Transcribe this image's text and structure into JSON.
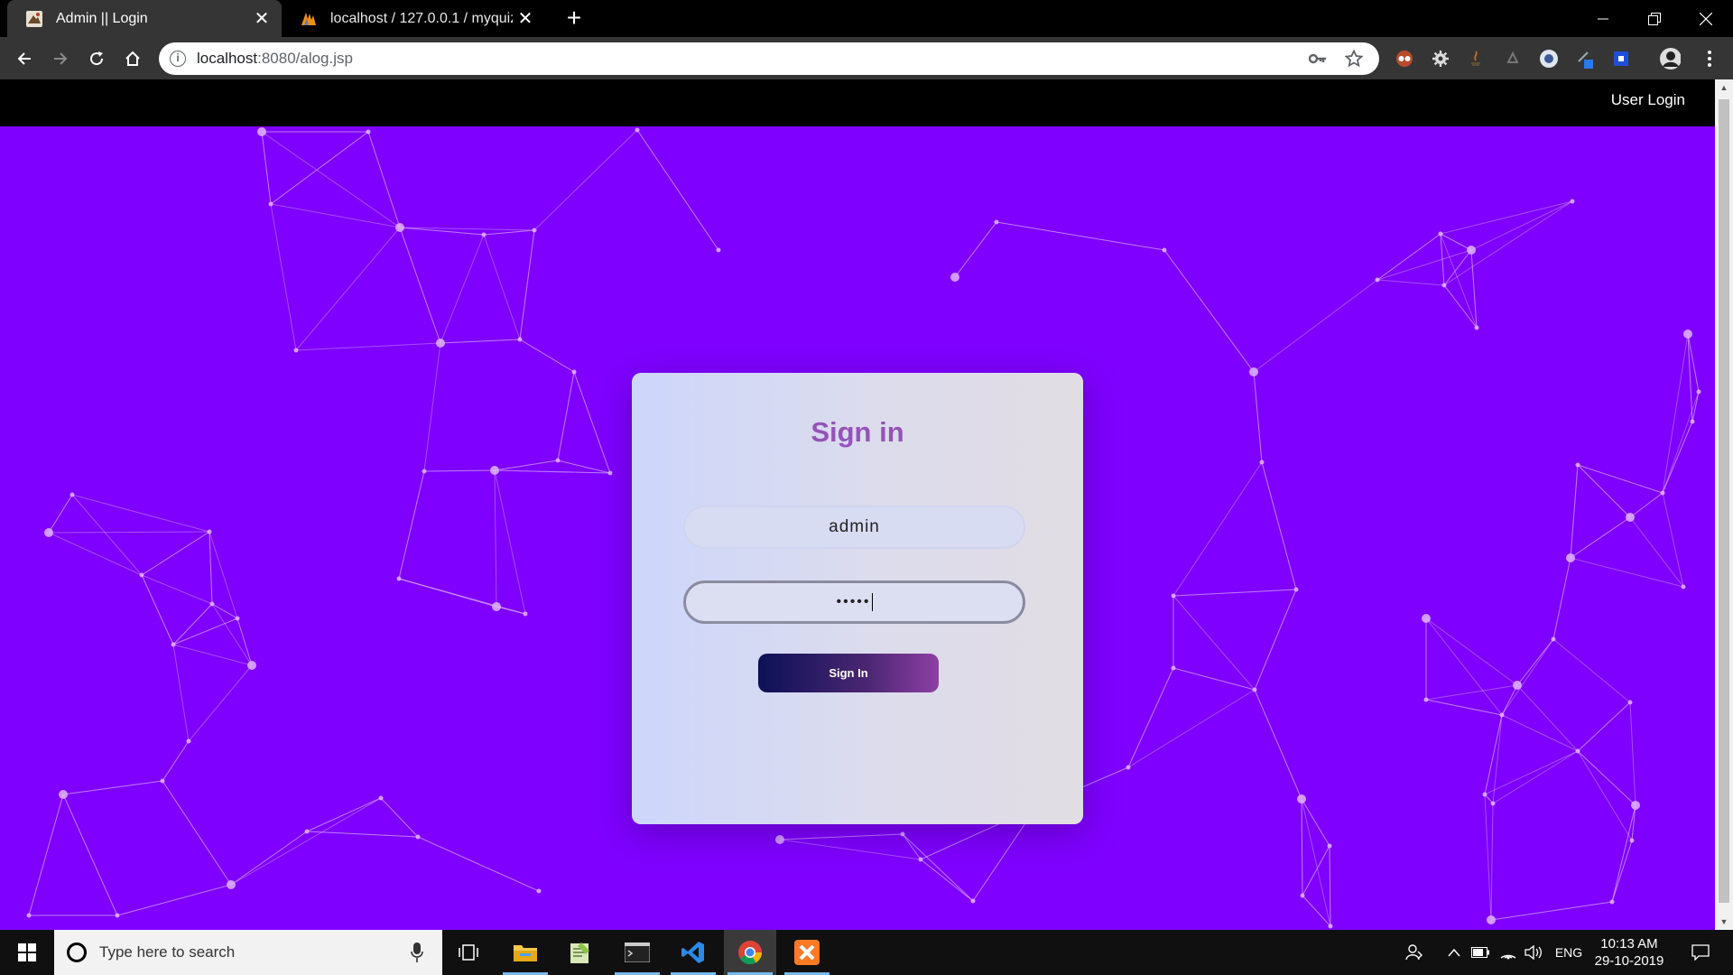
{
  "browser": {
    "tabs": [
      {
        "title": "Admin || Login",
        "active": true
      },
      {
        "title": "localhost / 127.0.0.1 / myquiz / u",
        "active": false
      }
    ],
    "new_tab": "+",
    "address": {
      "host": "localhost",
      "rest": ":8080/alog.jsp"
    }
  },
  "site": {
    "nav_link": "User Login",
    "background_color": "#7f00ff"
  },
  "login_card": {
    "title": "Sign in",
    "username_value": "admin",
    "password_value": "•••••",
    "button_label": "Sign In",
    "title_color": "#9553b8"
  },
  "taskbar": {
    "search_placeholder": "Type here to search",
    "language": "ENG",
    "time": "10:13 AM",
    "date": "29-10-2019",
    "apps": [
      "task-view-icon",
      "file-explorer-icon",
      "notepad-icon",
      "terminal-icon",
      "vscode-icon",
      "chrome-icon",
      "xampp-icon"
    ]
  }
}
